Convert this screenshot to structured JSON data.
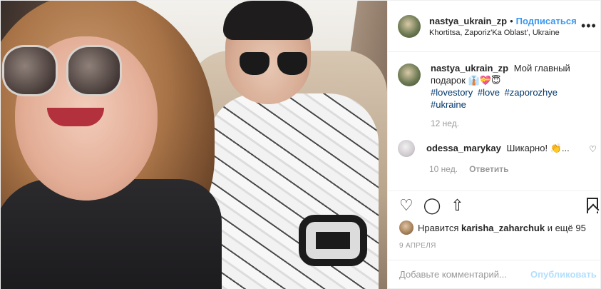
{
  "post": {
    "header": {
      "username": "nastya_ukrain_zp",
      "separator": "•",
      "follow_label": "Подписаться",
      "location": "Khortitsa, Zaporiz'Ka Oblast', Ukraine",
      "more_icon": "more-horizontal-icon"
    },
    "caption": {
      "username": "nastya_ukrain_zp",
      "text": "Мой главный подарок 👔💝😇",
      "hashtags": [
        "#lovestory",
        "#love",
        "#zaporozhye",
        "#ukraine"
      ],
      "time": "12 нед."
    },
    "comments": [
      {
        "username": "odessa_marykay",
        "text": "Шикарно! 👏...",
        "time": "10 нед.",
        "reply_label": "Ответить"
      }
    ],
    "actions": {
      "like_icon": "heart-icon",
      "comment_icon": "comment-icon",
      "share_icon": "share-icon",
      "save_icon": "bookmark-icon",
      "like_glyph": "♡",
      "comment_glyph": "◯",
      "share_glyph": "⇧",
      "small_heart_glyph": "♡"
    },
    "likes": {
      "prefix": "Нравится",
      "user": "karisha_zaharchuk",
      "suffix": "и ещё 95"
    },
    "date": "9 АПРЕЛЯ",
    "add_comment": {
      "placeholder": "Добавьте комментарий...",
      "publish_label": "Опубликовать"
    },
    "colors": {
      "link": "#3897f0",
      "hashtag": "#003569",
      "muted": "#999999",
      "publish_disabled": "#b2dffc"
    }
  }
}
